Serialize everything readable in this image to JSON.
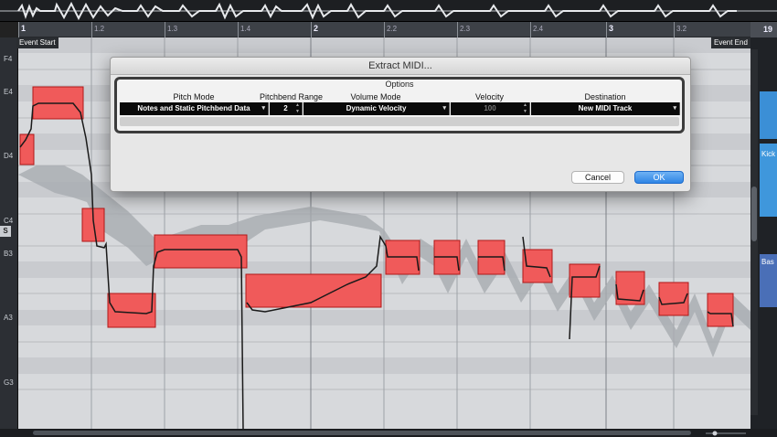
{
  "ruler": {
    "bars": [
      {
        "label": "1",
        "major": true
      },
      {
        "label": "1.2",
        "major": false
      },
      {
        "label": "1.3",
        "major": false
      },
      {
        "label": "1.4",
        "major": false
      },
      {
        "label": "2",
        "major": true
      },
      {
        "label": "2.2",
        "major": false
      },
      {
        "label": "2.3",
        "major": false
      },
      {
        "label": "2.4",
        "major": false
      },
      {
        "label": "3",
        "major": true
      },
      {
        "label": "3.2",
        "major": false
      }
    ],
    "right_bar": "19"
  },
  "events": {
    "start": "Event Start",
    "end": "Event End"
  },
  "keys": [
    "F4",
    "E4",
    "D4",
    "C4",
    "B3",
    "A3",
    "G3"
  ],
  "s_marker": "S",
  "right_panel": {
    "clips": [
      "Kick",
      "Bas"
    ]
  },
  "dialog": {
    "title": "Extract MIDI...",
    "options_title": "Options",
    "columns": {
      "pitch_mode": "Pitch Mode",
      "pitchbend_range": "Pitchbend Range",
      "volume_mode": "Volume Mode",
      "velocity": "Velocity",
      "destination": "Destination"
    },
    "values": {
      "pitch_mode": "Notes and Static Pitchbend Data",
      "pitchbend_range": "2",
      "volume_mode": "Dynamic Velocity",
      "velocity": "100",
      "destination": "New MIDI Track"
    },
    "cancel_label": "Cancel",
    "ok_label": "OK"
  },
  "colors": {
    "note_fill": "#f05a5a",
    "note_border": "#b01818",
    "accent": "#2f85e5"
  }
}
